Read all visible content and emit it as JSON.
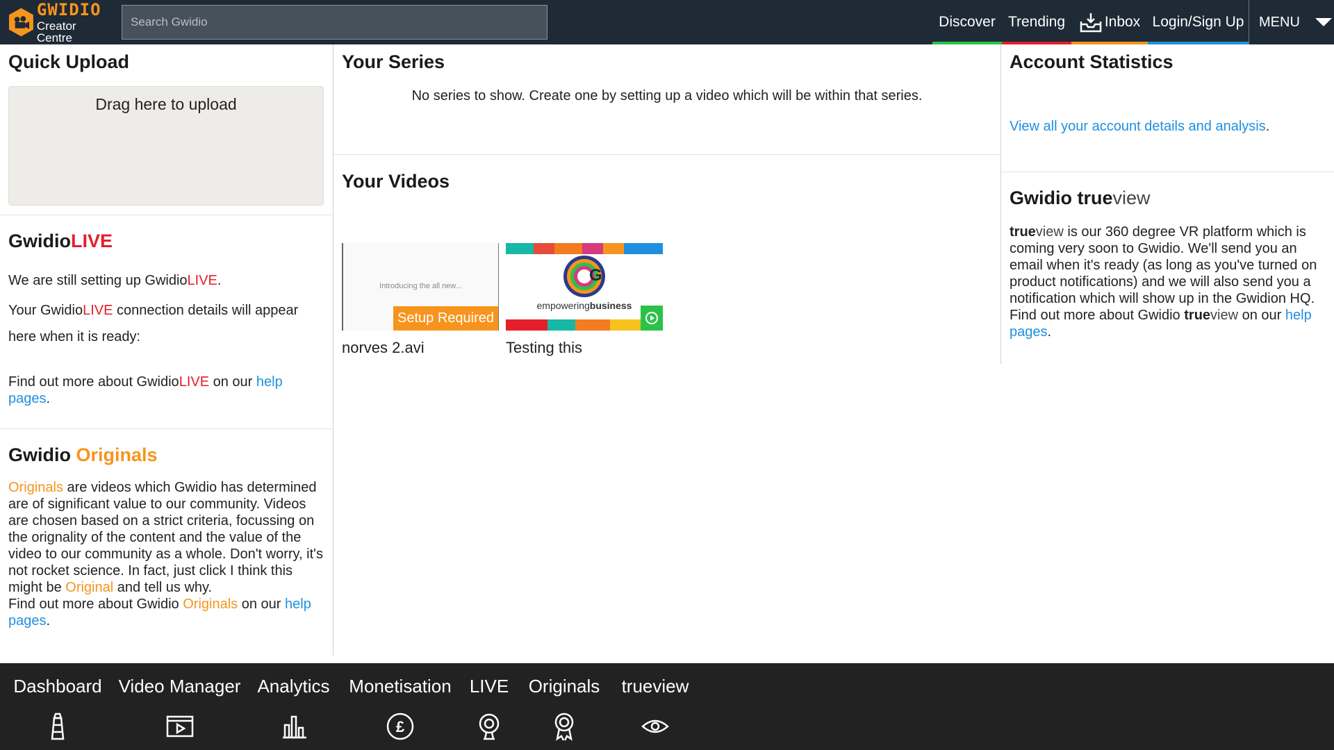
{
  "header": {
    "brand": "GWIDIO",
    "subtitle": "Creator Centre",
    "search_placeholder": "Search Gwidio",
    "nav": [
      {
        "label": "Discover",
        "color": "#2bc24a"
      },
      {
        "label": "Trending",
        "color": "#e41e2b"
      },
      {
        "label": "Inbox",
        "color": "#f7941d"
      },
      {
        "label": "Login/Sign Up",
        "color": "#1f8fe0"
      }
    ],
    "menu_label": "MENU"
  },
  "left": {
    "quick_upload": {
      "title": "Quick Upload",
      "drop_text": "Drag here to upload"
    },
    "live": {
      "title_a": "Gwidio",
      "title_b": "LIVE",
      "line1_a": "We are still setting up Gwidio",
      "line1_b": "LIVE",
      "line1_c": ".",
      "line2_a": "Your Gwidio",
      "line2_b": "LIVE",
      "line2_c": " connection details will appear here when it is ready:",
      "more_a": "Find out more about Gwidio",
      "more_b": "LIVE",
      "more_c": " on our ",
      "more_link": "help pages",
      "more_d": "."
    },
    "originals": {
      "title_a": "Gwidio ",
      "title_b": "Originals",
      "p_a": "Originals",
      "p_b": " are videos which Gwidio has determined are of significant value to our community. Videos are chosen based on a strict criteria, focussing on the orignality of the content and the value of the video to our community as a whole. Don't worry, it's not rocket science. In fact, just click I think this might be ",
      "p_c": "Original",
      "p_d": " and tell us why.",
      "more_a": "Find out more about Gwidio ",
      "more_b": "Originals",
      "more_c": " on our ",
      "more_link": "help pages",
      "more_d": "."
    }
  },
  "middle": {
    "series": {
      "title": "Your Series",
      "empty_text": "No series to show. Create one by setting up a video which will be within that series."
    },
    "videos": {
      "title": "Your Videos",
      "items": [
        {
          "title": "norves 2.avi",
          "thumb_text": "Introducing the all new...",
          "badge": "Setup Required"
        },
        {
          "title": "Testing this",
          "thumb_caption_a": "empowering",
          "thumb_caption_b": "business"
        }
      ]
    }
  },
  "right": {
    "stats": {
      "title": "Account Statistics",
      "link": "View all your account details and analysis",
      "link_end": "."
    },
    "trueview": {
      "title_a": "Gwidio ",
      "title_b": "true",
      "title_c": "view",
      "p_a": "true",
      "p_b": "view",
      "p_c": " is our 360 degree VR platform which is coming very soon to Gwidio. We'll send you an email when it's ready (as long as you've turned on product notifications) and we will also send you a notification which will show up in the Gwidion HQ.",
      "more_a": "Find out more about Gwidio ",
      "more_b": "true",
      "more_c": "view",
      "more_d": " on our ",
      "more_link": "help pages",
      "more_e": "."
    }
  },
  "footer": {
    "items": [
      {
        "label": "Dashboard",
        "icon": "lighthouse-icon"
      },
      {
        "label": "Video Manager",
        "icon": "video-player-icon"
      },
      {
        "label": "Analytics",
        "icon": "bar-chart-icon"
      },
      {
        "label": "Monetisation",
        "icon": "pound-icon"
      },
      {
        "label": "LIVE",
        "icon": "webcam-icon"
      },
      {
        "label": "Originals",
        "icon": "rosette-icon"
      },
      {
        "label": "trueview",
        "icon": "eye-icon"
      }
    ]
  }
}
